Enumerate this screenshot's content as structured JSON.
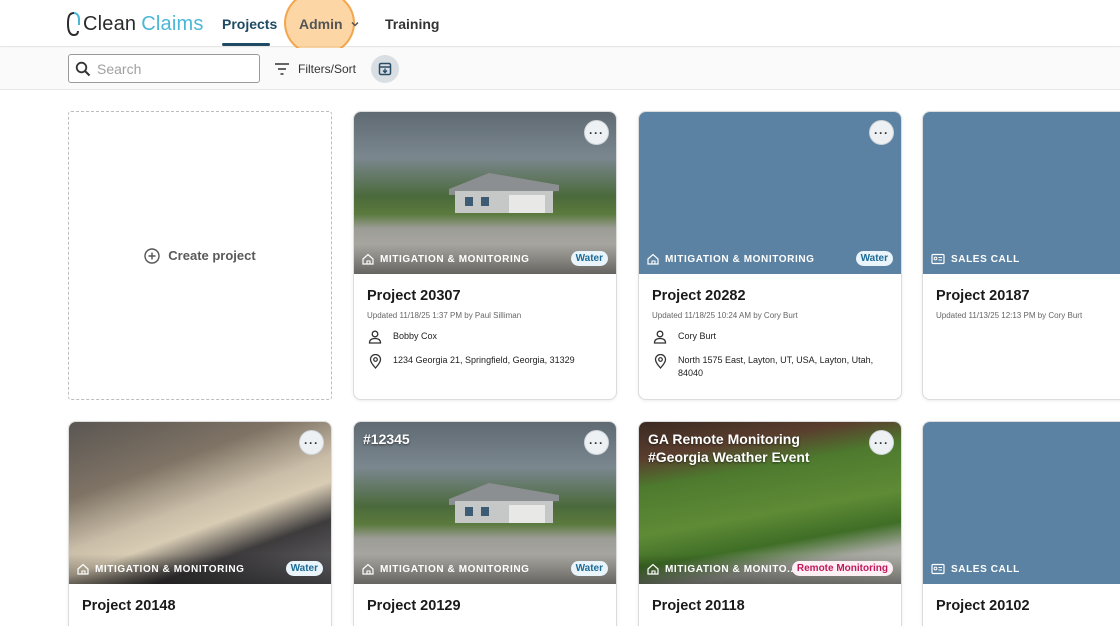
{
  "brand": {
    "name_part1": "Clean",
    "name_part2": "Claims",
    "accent": "#4bb7d6",
    "primary": "#1e4b63"
  },
  "nav": {
    "projects": "Projects",
    "admin": "Admin",
    "training": "Training"
  },
  "toolbar": {
    "search_placeholder": "Search",
    "filters_label": "Filters/Sort"
  },
  "create": {
    "label": "Create project"
  },
  "cards": [
    {
      "title": "Project 20307",
      "updated": "Updated 11/18/25 1:37 PM by Paul Silliman",
      "type": "MITIGATION & MONITORING",
      "type_icon": "home-shield-icon",
      "badge": "Water",
      "contact": "Bobby Cox",
      "address": "1234 Georgia 21, Springfield, Georgia, 31329",
      "image": "house-photo"
    },
    {
      "title": "Project 20282",
      "updated": "Updated 11/18/25 10:24 AM by Cory Burt",
      "type": "MITIGATION & MONITORING",
      "type_icon": "home-shield-icon",
      "badge": "Water",
      "contact": "Cory Burt",
      "address": "North 1575 East, Layton, UT, USA, Layton, Utah, 84040",
      "image": "placeholder-blue"
    },
    {
      "title": "Project 20187",
      "updated": "Updated 11/13/25 12:13 PM by Cory Burt",
      "type": "SALES CALL",
      "type_icon": "contact-card-icon",
      "image": "placeholder-blue"
    },
    {
      "title": "Project 20148",
      "type": "MITIGATION & MONITORING",
      "type_icon": "home-shield-icon",
      "badge": "Water",
      "image": "insulation-photo"
    },
    {
      "title": "Project 20129",
      "overlay_title": "#12345",
      "type": "MITIGATION & MONITORING",
      "type_icon": "home-shield-icon",
      "badge": "Water",
      "image": "house-photo"
    },
    {
      "title": "Project 20118",
      "overlay_title_line1": "GA Remote Monitoring",
      "overlay_title_line2": "#Georgia Weather Event",
      "type": "MITIGATION & MONITO...",
      "type_icon": "home-shield-icon",
      "badge": "Remote Monitoring",
      "image": "lawn-photo"
    },
    {
      "title": "Project 20102",
      "type": "SALES CALL",
      "type_icon": "contact-card-icon",
      "image": "placeholder-blue"
    }
  ]
}
